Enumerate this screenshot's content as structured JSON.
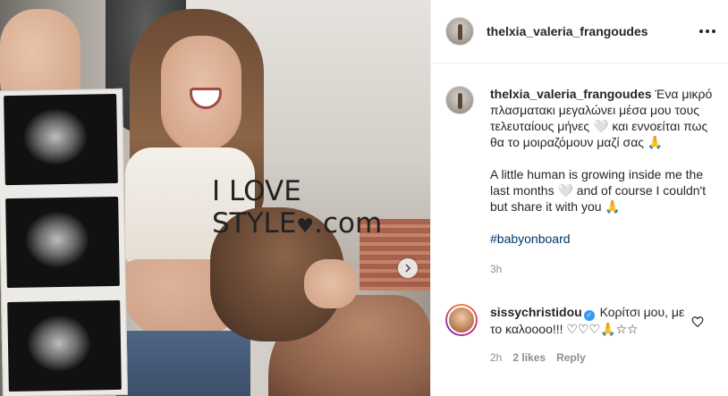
{
  "watermark": {
    "text": "I LOVE STYLE",
    "heart": "♥",
    "suffix": ".com"
  },
  "post": {
    "author": "thelxia_valeria_frangoudes",
    "caption": {
      "username": "thelxia_valeria_frangoudes",
      "greek": "Ένα μικρό πλασματακι μεγαλώνει μέσα μου τους τελευταίους μήνες 🤍 και εννοείται πως θα το μοιραζόμουν μαζί σας 🙏",
      "english": "A little human is growing inside me the last months 🤍 and of course I couldn't but share it with you 🙏",
      "hashtag": "#babyonboard",
      "time": "3h"
    },
    "comment": {
      "username": "sissychristidou",
      "verified": "✓",
      "text": "Κορίτσι μου, με το καλοοοο!!! ♡♡♡🙏☆☆",
      "time": "2h",
      "likes": "2 likes",
      "reply": "Reply"
    }
  },
  "colors": {
    "link": "#00376b",
    "muted": "#8e8e8e",
    "text": "#262626",
    "verified": "#3897f0"
  }
}
